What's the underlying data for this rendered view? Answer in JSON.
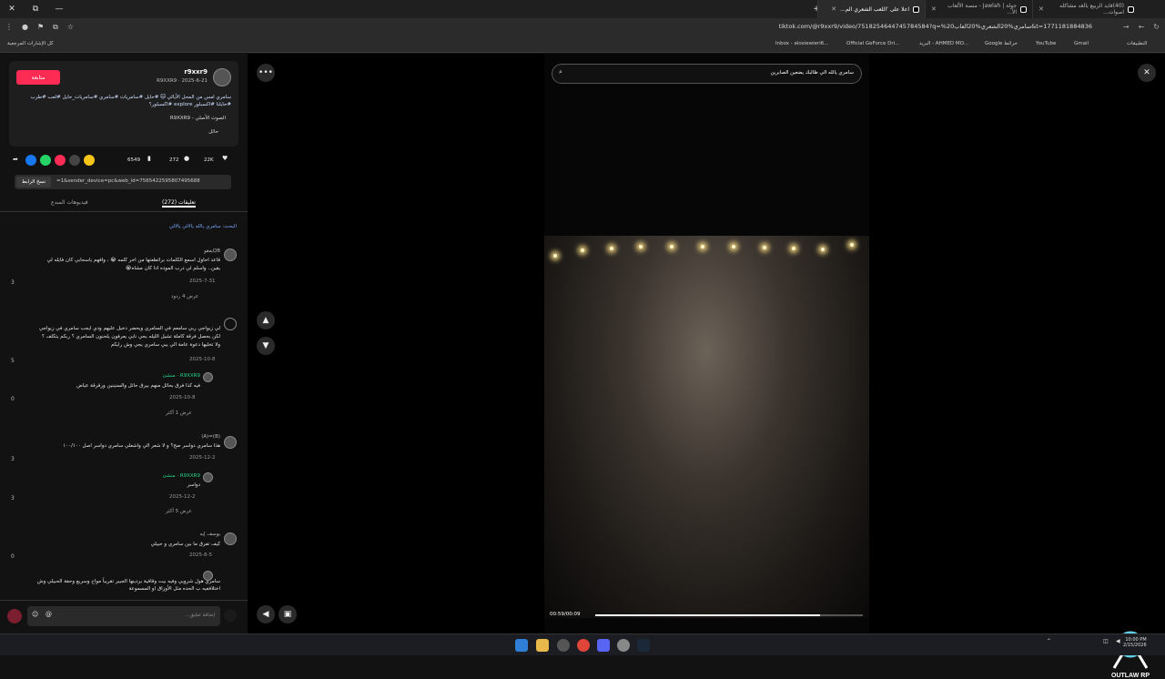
{
  "tabs": [
    {
      "label": "(40)فايد الربيع بالغد مشاكله اصوات..."
    },
    {
      "label": "جولة | Jawlah - منصة الألعاب الأ..."
    },
    {
      "label": "اعلا على 'اللعب الشعري الم..."
    }
  ],
  "url": "tiktok.com/@r9xxr9/video/7518254644745784584?q=%20سامري%20الشعري%20العاب&t=1771181884836",
  "bookmarks": {
    "folder": "كل الإشارات المرجعية",
    "apps": "التطبيقات",
    "items": [
      "Gmail",
      "YouTube",
      "Google خرائط",
      "البريد - AHMED MO...",
      "Official GeForce Dri...",
      "Inbox - alosiewieri6..."
    ]
  },
  "post": {
    "username": "r9xxr9",
    "handle": "R9XXR9 · 2025-6-21",
    "follow": "متابعة",
    "caption": "سامري امس من المحل الأيالي 🐱 #حايل #سامريات #سامري #سامريات_حايل #لعب #طرب #حايلنا #اكسبلور explore #اكسبلور؟",
    "sound": "الصوت الأصلي - R9XXR9",
    "location": "حائل",
    "likes": "22K",
    "comments": "272",
    "saves": "6549",
    "link": "=1&sender_device=pc&web_id=7565422595807495688",
    "copy": "نسخ الرابط"
  },
  "panel_tabs": {
    "comments": "تعليقات (272)",
    "creator": "فيديوهات المبدع"
  },
  "search_hint": "البحث: سامري يالله يالالي يالالي",
  "comments": [
    {
      "user": "QBيعقو",
      "text": "قاعد احاول اسمع الكلمات برائطعتها من اخر كلمه 😭 ، وافهم ياسحابي كان فايله لي يقين.. واسلم لي درب الموده ادا كان مشاه😭",
      "date": "2025-7-31",
      "likes": "3",
      "replies": "عرض 4 ردود"
    },
    {
      "user": "",
      "text": "لي زيواجي ربي سامعم في السامري ويحضر دخيل عليهم ودي ايجب سامري في زيواجي لكن بحصل فرقة كاملة تشيل الليله يحي نابي يعرفون يلحنون السامري ؟ ربكم يتكلف ؟ ولا تخليها دعوة عامة الي يبي سامري يجي وش رايكم",
      "date": "2025-10-8",
      "likes": "5"
    },
    {
      "user": "R9XXR9 · منشئ",
      "text": "فيه كذا فرق بحائل منهم بيرق حائل والسنينين ورقرقة عياض",
      "date": "2025-10-8",
      "likes": "0",
      "replies": "عرض 1 أكثر"
    },
    {
      "user": "(B)=(A)",
      "text": "هذا سامري دواسر صح؟ و لا شعر الي واشعلي سامري دواسر اصل ١٠٠/١٠٠",
      "date": "2025-12-2",
      "likes": "3"
    },
    {
      "user": "R9XXR9 · منشئ",
      "text": "دواسر",
      "date": "2025-12-2",
      "likes": "3",
      "replies": "عرض 5 أكثر"
    },
    {
      "user": "يوسف إيه",
      "text": "كيف تفرق ما بين سامري و حبيلي",
      "date": "2025-8-5",
      "likes": "0"
    },
    {
      "user": "",
      "text": "سامري هول شرويي وفيه بيت وقافية بردينها الجبير تقريباً مواخ وسريع وحفة الحبيلي وش اختلاففيه ب الحده مثل الأوزاق او المسموعة",
      "date": "",
      "likes": ""
    }
  ],
  "comment_placeholder": "إضافة تعليق...",
  "video": {
    "search": "سامري يالله الي ظالبك يضعين الصابرين",
    "time": "00:59/00:09",
    "progress": 0.84
  },
  "watermark": "OUTLAW RP",
  "clock": {
    "time": "10:00 PM",
    "date": "2/15/2026"
  },
  "colors": {
    "follow": "#fe2c55",
    "creator": "#25d48a",
    "hashtag": "#7aa7ff"
  }
}
